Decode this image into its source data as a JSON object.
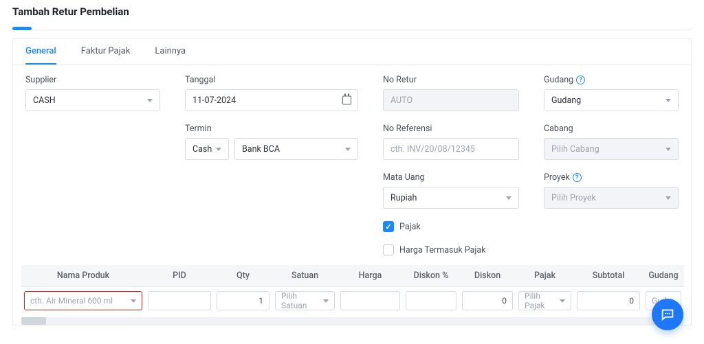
{
  "page_title": "Tambah Retur Pembelian",
  "tabs": {
    "general": "General",
    "faktur": "Faktur Pajak",
    "lainnya": "Lainnya"
  },
  "labels": {
    "supplier": "Supplier",
    "tanggal": "Tanggal",
    "no_retur": "No Retur",
    "gudang": "Gudang",
    "termin": "Termin",
    "no_ref": "No Referensi",
    "cabang": "Cabang",
    "mata_uang": "Mata Uang",
    "proyek": "Proyek",
    "pajak_cb": "Pajak",
    "harga_termasuk": "Harga Termasuk Pajak"
  },
  "values": {
    "supplier": "CASH",
    "tanggal": "11-07-2024",
    "no_retur": "AUTO",
    "gudang": "Gudang",
    "termin_type": "Cash",
    "termin_bank": "Bank BCA",
    "no_ref_ph": "cth. INV/20/08/12345",
    "cabang_ph": "Pilih Cabang",
    "mata_uang": "Rupiah",
    "proyek_ph": "Pilih Proyek"
  },
  "table": {
    "headers": {
      "nama": "Nama Produk",
      "pid": "PID",
      "qty": "Qty",
      "satuan": "Satuan",
      "harga": "Harga",
      "diskon_pct": "Diskon %",
      "diskon": "Diskon",
      "pajak": "Pajak",
      "subtotal": "Subtotal",
      "gudang": "Gudang"
    },
    "row": {
      "nama_ph": "cth. Air Mineral 600 ml",
      "qty": "1",
      "satuan_ph": "Pilih Satuan",
      "diskon": "0",
      "pajak_ph": "Pilih Pajak",
      "subtotal": "0",
      "gudang_ph": "Guda"
    }
  }
}
